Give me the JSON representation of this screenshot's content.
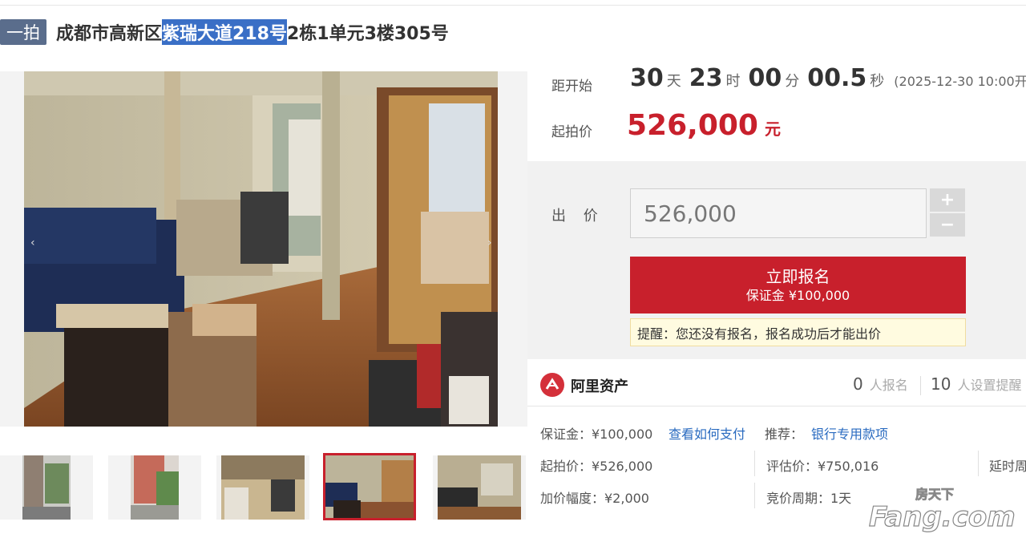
{
  "header": {
    "badge": "一拍",
    "title_prefix": "成都市高新区",
    "title_highlight": "紫瑞大道218号",
    "title_suffix": "2栋1单元3楼305号"
  },
  "auction": {
    "countdown_label": "距开始",
    "days": "30",
    "days_unit": "天",
    "hours": "23",
    "hours_unit": "时",
    "minutes": "00",
    "minutes_unit": "分",
    "seconds": "00.5",
    "seconds_unit": "秒",
    "start_time": "(2025-12-30 10:00开始)",
    "start_price_label": "起拍价",
    "start_price": "526,000",
    "start_price_unit": "元"
  },
  "bid": {
    "label": "出 价",
    "value": "526,000",
    "plus": "+",
    "minus": "−",
    "signup_label": "立即报名",
    "deposit_label": "保证金 ¥100,000",
    "tip": "提醒：您还没有报名，报名成功后才能出价"
  },
  "platform": {
    "name": "阿里资产",
    "signups_count": "0",
    "signups_label": "人报名",
    "reminders_count": "10",
    "reminders_label": "人设置提醒"
  },
  "details": {
    "deposit": "保证金：¥100,000",
    "how_to_pay": "查看如何支付",
    "recommend_label": "推荐：",
    "recommend_link": "银行专用款项",
    "start_price": "起拍价：¥526,000",
    "appraisal": "评估价：¥750,016",
    "delay": "延时周",
    "increment": "加价幅度：¥2,000",
    "cycle": "竞价周期：1天"
  },
  "watermark": {
    "brand_cn": "房天下",
    "brand_en": "Fang.com"
  },
  "colors": {
    "accent_red": "#c8202c",
    "highlight_blue": "#3a6fc6",
    "badge_slate": "#5a6d8c",
    "link_blue": "#2a6bc0"
  },
  "icons": {
    "zoom": "magnifier-icon",
    "prev": "chevron-left-icon",
    "next": "chevron-right-icon",
    "platform_logo": "ali-asset-logo-icon"
  }
}
